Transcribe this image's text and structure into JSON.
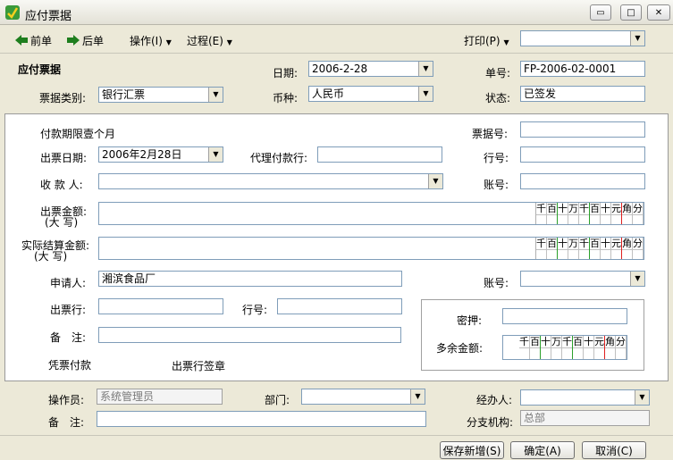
{
  "window": {
    "title": "应付票据",
    "min_label": "▭",
    "max_label": "□",
    "close_label": "✕"
  },
  "toolbar": {
    "prev_label": "前单",
    "next_label": "后单",
    "operate_label": "操作(I)",
    "process_label": "过程(E)",
    "print_label": "打印(P)",
    "print_value": ""
  },
  "header": {
    "section_title": "应付票据",
    "date_label": "日期:",
    "date_value": "2006-2-28",
    "number_label": "单号:",
    "number_value": "FP-2006-02-0001",
    "bill_type_label": "票据类别:",
    "bill_type_value": "银行汇票",
    "currency_label": "币种:",
    "currency_value": "人民币",
    "status_label": "状态:",
    "status_value": "已签发"
  },
  "body": {
    "period_text": "付款期限壹个月",
    "bill_no_label": "票据号:",
    "bill_no_value": "",
    "issue_date_label": "出票日期:",
    "issue_date_value": "2006年2月28日",
    "agent_bank_label": "代理付款行:",
    "agent_bank_value": "",
    "bank_no_label": "行号:",
    "bank_no_value": "",
    "payee_label": "收 款 人:",
    "payee_value": "",
    "account_label": "账号:",
    "account_value": "",
    "amount_label_1": "出票金额:",
    "amount_label_2": "(大 写)",
    "amount_value": "",
    "settle_label_1": "实际结算金额:",
    "settle_label_2": "(大 写)",
    "settle_value": "",
    "digits": [
      "千",
      "百",
      "十",
      "万",
      "千",
      "百",
      "十",
      "元",
      "角",
      "分"
    ],
    "applicant_label": "申请人:",
    "applicant_value": "湘滨食品厂",
    "account2_label": "账号:",
    "account2_value": "",
    "issue_bank_label": "出票行:",
    "issue_bank_value": "",
    "bank_no2_label": "行号:",
    "bank_no2_value": "",
    "note_label": "备　注:",
    "note_value": "",
    "voucher_text": "凭票付款",
    "sign_text": "出票行签章",
    "secret_label": "密押:",
    "secret_value": "",
    "surplus_label": "多余金额:"
  },
  "footer": {
    "operator_label": "操作员:",
    "operator_value": "系统管理员",
    "dept_label": "部门:",
    "dept_value": "",
    "handler_label": "经办人:",
    "handler_value": "",
    "note_label": "备　注:",
    "note_value": "",
    "branch_label": "分支机构:",
    "branch_value": "总部",
    "save_new_label": "保存新增(S)",
    "ok_label": "确定(A)",
    "cancel_label": "取消(C)"
  }
}
